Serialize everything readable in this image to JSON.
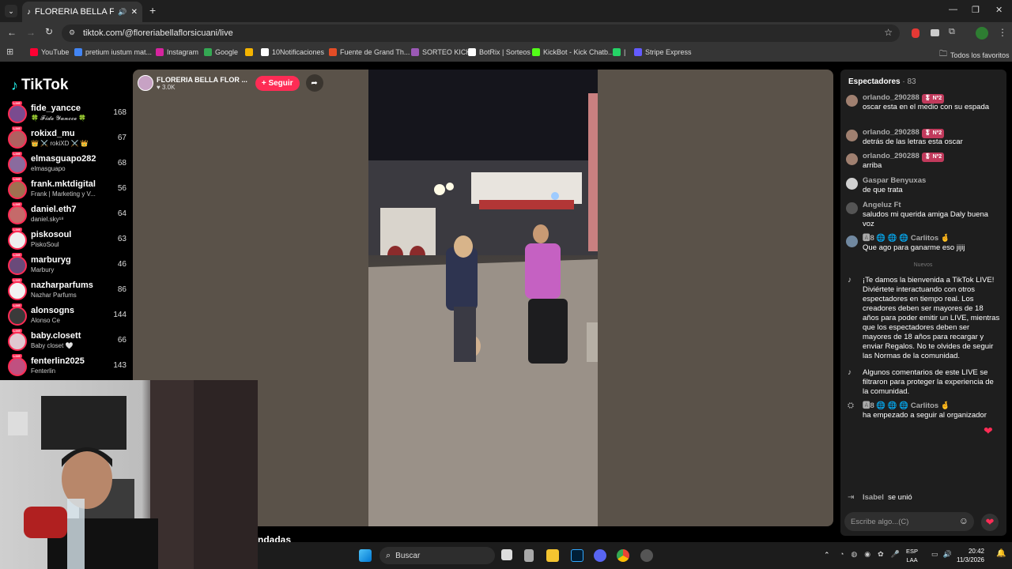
{
  "browser": {
    "tab_title": "FLORERIA BELLA FLOR SICU",
    "url": "tiktok.com/@floreriabellaflorsicuani/live",
    "bookmarks": [
      {
        "label": "YouTube",
        "color": "#ff0033"
      },
      {
        "label": "pretium iustum mat...",
        "color": "#4285f4"
      },
      {
        "label": "Instagram",
        "color": "#d6249f"
      },
      {
        "label": "Google",
        "color": "#34a853"
      },
      {
        "label": "",
        "color": "#f4b400"
      },
      {
        "label": "10Notificaciones",
        "color": "#ffffff"
      },
      {
        "label": "Fuente de Grand Th...",
        "color": "#e44d26"
      },
      {
        "label": "SORTEO KICK",
        "color": "#9b59b6"
      },
      {
        "label": "BotRix | Sorteos",
        "color": "#ffffff"
      },
      {
        "label": "KickBot - Kick Chatb...",
        "color": "#53fc18"
      },
      {
        "label": "|",
        "color": "#25d366"
      },
      {
        "label": "Stripe Express",
        "color": "#635bff"
      }
    ],
    "all_bookmarks": "Todos los favoritos"
  },
  "tiktok": {
    "logo": "TikTok",
    "suggested": [
      {
        "name": "fide_yancce",
        "sub": "🍀 𝓕𝓲𝓭𝓮 𝓨𝓪𝓷𝓬𝓬𝓮 🍀",
        "count": "168",
        "color": "#7a4b8f"
      },
      {
        "name": "rokixd_mu",
        "sub": "👑 ⚔️ rokiXD ⚔️ 👑",
        "count": "67",
        "color": "#b06060"
      },
      {
        "name": "elmasguapo282",
        "sub": "elmasguapo",
        "count": "68",
        "color": "#8a6b9e"
      },
      {
        "name": "frank.mktdigital",
        "sub": "Frank | Marketing y V...",
        "count": "56",
        "color": "#a07050"
      },
      {
        "name": "daniel.eth7",
        "sub": "daniel.sky¹⁸",
        "count": "64",
        "color": "#c56a6a"
      },
      {
        "name": "piskosoul",
        "sub": "PiskoSoul",
        "count": "63",
        "color": "#eee"
      },
      {
        "name": "marburyg",
        "sub": "Marbury",
        "count": "46",
        "color": "#6a4a7a"
      },
      {
        "name": "nazharparfums",
        "sub": "Nazhar Parfums",
        "count": "86",
        "color": "#f2f2f2"
      },
      {
        "name": "alonsogns",
        "sub": "Alonso Ce",
        "count": "144",
        "color": "#3a3a3a"
      },
      {
        "name": "baby.closett",
        "sub": "Baby closet 🤍",
        "count": "66",
        "color": "#e0c8d0"
      },
      {
        "name": "fenterlin2025",
        "sub": "Fenterlin",
        "count": "143",
        "color": "#c05080"
      }
    ],
    "host": {
      "name": "FLORERIA BELLA FLOR ...",
      "likes": "♥ 3.0K",
      "follow_label": "+ Seguir"
    },
    "chat": {
      "header": "Espectadores",
      "viewer_count": "· 83",
      "messages": [
        {
          "user": "orlando_290288",
          "badge": "🎖 Nº2",
          "text": "oscar esta en el medio con su espada"
        },
        {
          "user": "orlando_290288",
          "badge": "🎖 Nº2",
          "text": "detrás de las letras esta oscar"
        },
        {
          "user": "orlando_290288",
          "badge": "🎖 Nº2",
          "text": "arriba"
        },
        {
          "user": "Gaspar Benyuxas",
          "badge": "",
          "text": "de que trata"
        },
        {
          "user": "Angeluz Ft",
          "badge": "",
          "text": "saludos mi querida amiga Daly buena voz"
        },
        {
          "user": "🅰8 🌐 🌐 🌐 Carlitos 🤞",
          "badge": "",
          "text": "Que ago para ganarme eso jijij"
        }
      ],
      "divider": "Nuevos",
      "system": [
        {
          "text": "¡Te damos la bienvenida a TikTok LIVE! Diviértete interactuando con otros espectadores en tiempo real. Los creadores deben ser mayores de 18 años para poder emitir un LIVE, mientras que los espectadores deben ser mayores de 18 años para recargar y enviar Regalos. No te olvides de seguir las Normas de la comunidad."
        },
        {
          "text": "Algunos comentarios de este LIVE se filtraron para proteger la experiencia de la comunidad."
        }
      ],
      "follow_event": {
        "user": "🅰8 🌐 🌐 🌐 Carlitos 🤞",
        "text": "ha empezado a seguir al organizador"
      },
      "join_event": {
        "user": "Isabel",
        "text": "se unió"
      },
      "input_placeholder": "Escribe algo...(C)"
    },
    "bottom_text": "ndadas"
  },
  "taskbar": {
    "search_label": "Buscar",
    "lang_top": "ESP",
    "lang_bottom": "LAA",
    "time": "20:42",
    "date": "11/3/2026"
  }
}
